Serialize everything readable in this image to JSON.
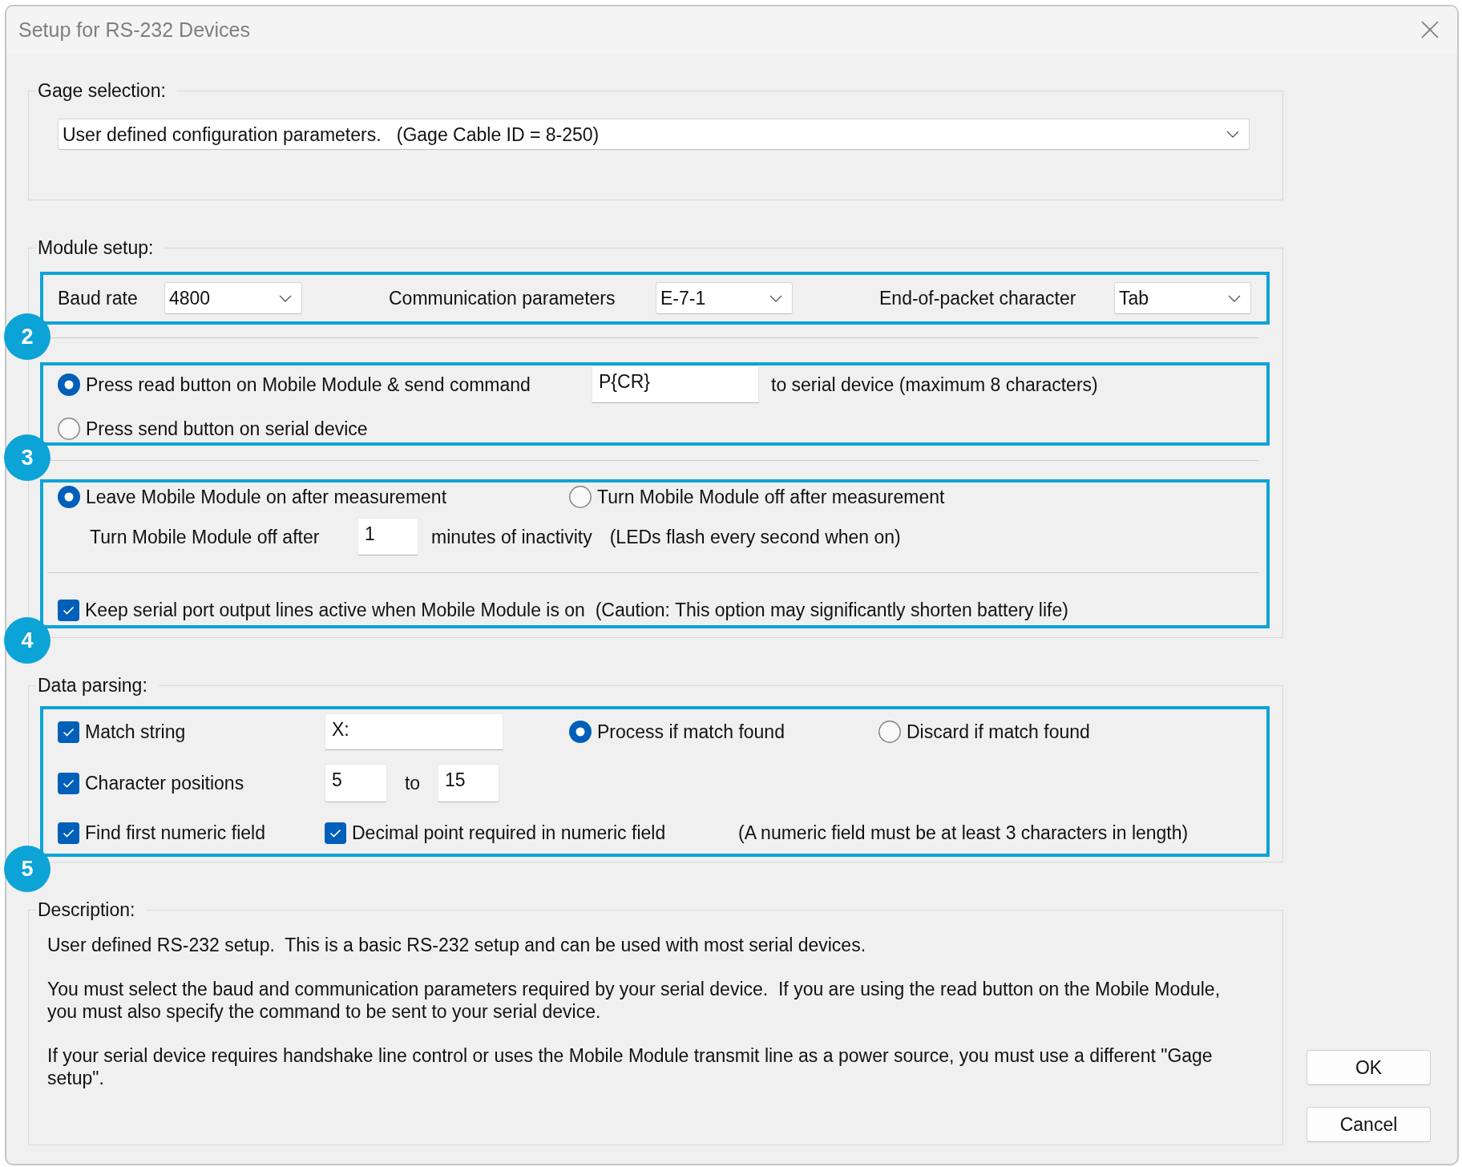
{
  "window": {
    "title": "Setup for RS-232 Devices"
  },
  "gage_selection": {
    "label": "Gage selection:",
    "value": "User defined configuration parameters.   (Gage Cable ID = 8-250)"
  },
  "module_setup": {
    "label": "Module setup:",
    "port_settings": {
      "badge": "2",
      "fields": [
        {
          "label": "Baud rate",
          "value": "4800"
        },
        {
          "label": "Communication parameters",
          "value": "E-7-1"
        },
        {
          "label": "End-of-packet character",
          "value": "Tab"
        }
      ]
    },
    "trigger": {
      "badge": "3",
      "options": [
        {
          "label": "Press read button on Mobile Module & send command",
          "selected": true
        },
        {
          "label": "Press send button on serial device",
          "selected": false
        }
      ],
      "command": "P{CR}",
      "command_note": "to serial device (maximum 8 characters)"
    },
    "power": {
      "badge": "4",
      "options": [
        {
          "label": "Leave Mobile Module on after measurement",
          "selected": true
        },
        {
          "label": "Turn Mobile Module off after measurement",
          "selected": false
        }
      ],
      "timeout_label": "Turn Mobile Module off after",
      "timeout_value": "1",
      "timeout_unit": "minutes of inactivity",
      "timeout_note": "(LEDs flash every second when on)",
      "keep_lines": {
        "label": "Keep serial port output lines active when Mobile Module is on  (Caution: This option may significantly shorten battery life)",
        "checked": true
      }
    }
  },
  "data_parsing": {
    "label": "Data parsing:",
    "badge": "5",
    "match_string": {
      "label": "Match string",
      "checked": true,
      "value": "X:"
    },
    "match_actions": [
      {
        "label": "Process if match found",
        "selected": true
      },
      {
        "label": "Discard if match found",
        "selected": false
      }
    ],
    "character_positions": {
      "label": "Character positions",
      "checked": true,
      "from": "5",
      "to_label": "to",
      "to": "15"
    },
    "find_numeric": {
      "label": "Find first numeric field",
      "checked": true
    },
    "decimal_required": {
      "label": "Decimal point required in numeric field",
      "checked": true
    },
    "note": "(A numeric field must be at least 3 characters in length)"
  },
  "description": {
    "label": "Description:",
    "paragraphs": [
      "User defined RS-232 setup.  This is a basic RS-232 setup and can be used with most serial devices.",
      "You must select the baud and communication parameters required by your serial device.  If you are using the read button on the Mobile Module, you must also specify the command to be sent to your serial device.",
      "If your serial device requires handshake line control or uses the Mobile Module transmit line as a power source, you must use a different \"Gage setup\"."
    ]
  },
  "buttons": [
    "OK",
    "Cancel"
  ]
}
